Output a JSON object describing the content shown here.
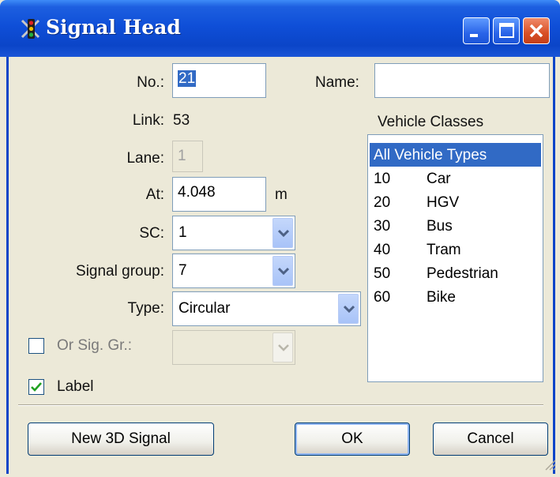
{
  "window": {
    "title": "Signal Head"
  },
  "fields": {
    "no_label": "No.:",
    "no_value": "21",
    "name_label": "Name:",
    "name_value": "",
    "link_label": "Link:",
    "link_value": "53",
    "lane_label": "Lane:",
    "lane_value": "1",
    "at_label": "At:",
    "at_value": "4.048",
    "at_unit": "m",
    "sc_label": "SC:",
    "sc_value": "1",
    "signal_group_label": "Signal group:",
    "signal_group_value": "7",
    "type_label": "Type:",
    "type_value": "Circular",
    "or_sig_gr_label": "Or Sig. Gr.:",
    "or_sig_gr_checked": false,
    "or_sig_gr_value": "",
    "label_label": "Label",
    "label_checked": true
  },
  "vehicle_classes": {
    "header": "Vehicle Classes",
    "items": [
      {
        "code": "All Vehicle Types",
        "name": "",
        "selected": true
      },
      {
        "code": "10",
        "name": "Car",
        "selected": false
      },
      {
        "code": "20",
        "name": "HGV",
        "selected": false
      },
      {
        "code": "30",
        "name": "Bus",
        "selected": false
      },
      {
        "code": "40",
        "name": "Tram",
        "selected": false
      },
      {
        "code": "50",
        "name": "Pedestrian",
        "selected": false
      },
      {
        "code": "60",
        "name": "Bike",
        "selected": false
      }
    ]
  },
  "buttons": {
    "new_3d_signal": "New 3D Signal",
    "ok": "OK",
    "cancel": "Cancel"
  },
  "icons": {
    "title": "traffic-light-icon",
    "minimize": "minimize-icon",
    "maximize": "maximize-icon",
    "close": "close-icon",
    "dropdown": "chevron-down-icon",
    "check": "checkmark-icon",
    "grip": "resize-grip-icon"
  },
  "colors": {
    "titlebar": "#0b45c8",
    "dialog_bg": "#ece9d8",
    "selection": "#316ac5",
    "close_button": "#d85026"
  }
}
